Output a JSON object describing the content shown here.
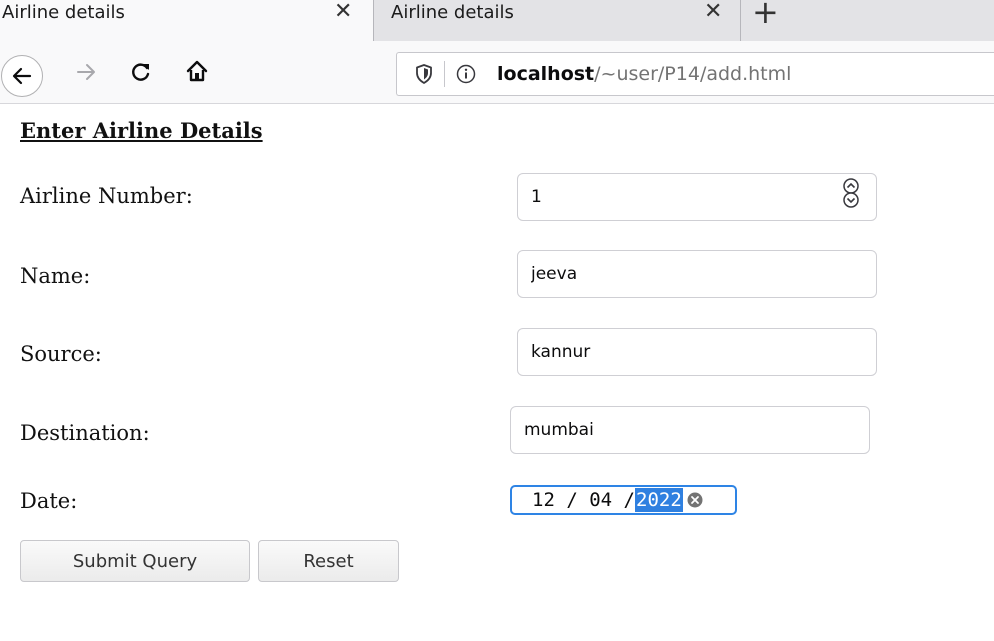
{
  "browser": {
    "tabs": [
      {
        "title": "Airline details",
        "active": true
      },
      {
        "title": "Airline details",
        "active": false
      }
    ],
    "url": {
      "host": "localhost",
      "path": "/~user/P14/add.html"
    }
  },
  "form": {
    "title": "Enter Airline Details",
    "fields": {
      "airline_number": {
        "label": "Airline Number:",
        "value": "1"
      },
      "name": {
        "label": "Name:",
        "value": "jeeva"
      },
      "source": {
        "label": "Source:",
        "value": "kannur"
      },
      "destination": {
        "label": "Destination:",
        "value": "mumbai"
      },
      "date": {
        "label": "Date:",
        "day": "12",
        "month": "04",
        "year": "2022"
      }
    },
    "buttons": {
      "submit": "Submit Query",
      "reset": "Reset"
    }
  },
  "colors": {
    "focus_accent": "#2e84e5",
    "selection": "#2f80e0"
  },
  "icons": [
    "close-icon",
    "plus-icon",
    "back-arrow-icon",
    "forward-arrow-icon",
    "reload-icon",
    "home-icon",
    "shield-icon",
    "info-icon",
    "spinner-icon",
    "clear-icon"
  ]
}
